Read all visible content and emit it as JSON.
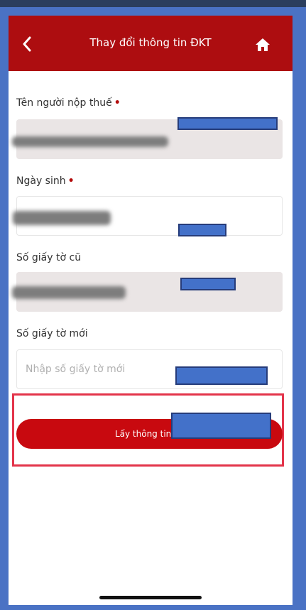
{
  "header": {
    "title": "Thay đổi thông tin ĐKT",
    "back_icon": "chevron-left-icon",
    "home_icon": "home-icon"
  },
  "form": {
    "taxpayer_name_label": "Tên người nộp thuế",
    "birthdate_label": "Ngày sinh",
    "old_id_label": "Số giấy tờ cũ",
    "new_id_label": "Số giấy tờ mới",
    "new_id_placeholder": "Nhập số giấy tờ mới",
    "required_marker": "•"
  },
  "actions": {
    "fetch_button_label": "Lấy thông tin cô"
  },
  "colors": {
    "header_bg": "#ad0d10",
    "button_bg": "#c8090f",
    "highlight_border": "#e3344a",
    "redaction": "#4371c9"
  }
}
